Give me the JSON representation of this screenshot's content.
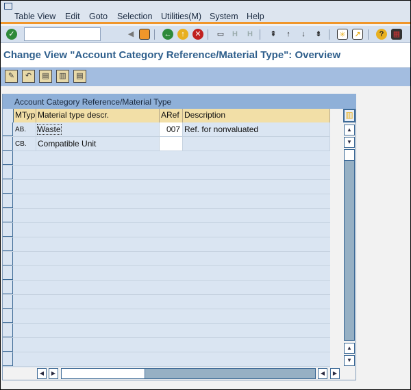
{
  "menu": [
    {
      "label": "Table View"
    },
    {
      "label": "Edit"
    },
    {
      "label": "Goto"
    },
    {
      "label": "Selection"
    },
    {
      "label": "Utilities(M)"
    },
    {
      "label": "System"
    },
    {
      "label": "Help"
    }
  ],
  "toolbar": {
    "command_value": "",
    "icons": [
      "enter-icon",
      "back-icon",
      "save-icon",
      "back-green-icon",
      "exit-icon",
      "cancel-icon",
      "print-icon",
      "find-icon",
      "find-next-icon",
      "first-page-icon",
      "prev-page-icon",
      "next-page-icon",
      "last-page-icon",
      "new-session-icon",
      "shortcut-icon",
      "help-icon",
      "layout-icon"
    ]
  },
  "title": "Change View \"Account Category Reference/Material Type\": Overview",
  "app_toolbar": [
    "display-change-icon",
    "undo-icon",
    "select-all-icon",
    "select-block-icon",
    "deselect-all-icon"
  ],
  "table": {
    "title": "Account Category Reference/Material Type",
    "columns": [
      "MTyp",
      "Material type descr.",
      "ARef",
      "Description"
    ],
    "rows": [
      {
        "mtyp": "AB.",
        "descr": "Waste",
        "aref": "007",
        "description": "Ref. for nonvaluated"
      },
      {
        "mtyp": "CB.",
        "descr": "Compatible Unit",
        "aref": "",
        "description": ""
      }
    ]
  },
  "colors": {
    "title": "#2f5f8c",
    "accent": "#f0962a",
    "header": "#f2dfa7",
    "table_bg": "#dae5f2"
  }
}
